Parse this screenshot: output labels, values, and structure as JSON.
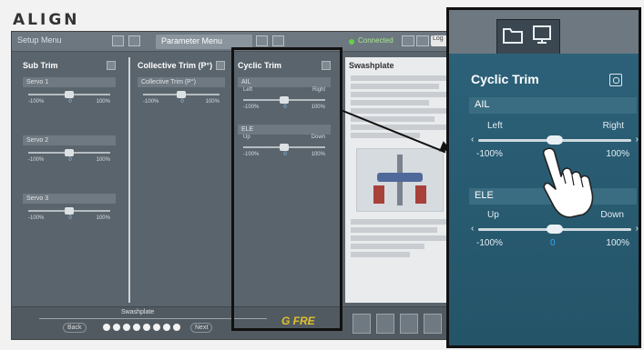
{
  "logo": "ALIGN",
  "app": {
    "tabs": {
      "setup": "Setup Menu",
      "param": "Parameter Menu"
    },
    "status": "Connected",
    "right_button": "Log",
    "columns": {
      "subtrim": {
        "title": "Sub Trim",
        "groups": [
          "Servo 1",
          "Servo 2",
          "Servo 3"
        ],
        "left": "-100%",
        "mid": "0",
        "right": "100%"
      },
      "collective": {
        "title": "Collective Trim (P°)",
        "group": "Collective Trim (P°)",
        "left": "-100%",
        "mid": "0",
        "right": "100%"
      },
      "cyclic": {
        "title": "Cyclic Trim",
        "groups": [
          {
            "label": "AIL",
            "l": "Left",
            "r": "Right"
          },
          {
            "label": "ELE",
            "l": "Up",
            "r": "Down"
          }
        ],
        "left": "-100%",
        "mid": "0",
        "right": "100%"
      },
      "swash": {
        "title": "Swashplate"
      }
    },
    "bottom": {
      "label": "Swashplate",
      "back": "Back",
      "next": "Next",
      "brand": "G FRE"
    }
  },
  "zoom": {
    "title": "Cyclic Trim",
    "ail": {
      "label": "AIL",
      "left_label": "Left",
      "right_label": "Right",
      "min": "-100%",
      "max": "100%"
    },
    "ele": {
      "label": "ELE",
      "left_label": "Up",
      "right_label": "Down",
      "min": "-100%",
      "mid": "0",
      "max": "100%"
    }
  },
  "colors": {
    "panel": "#2a5d72",
    "accent": "#39a9f0"
  }
}
